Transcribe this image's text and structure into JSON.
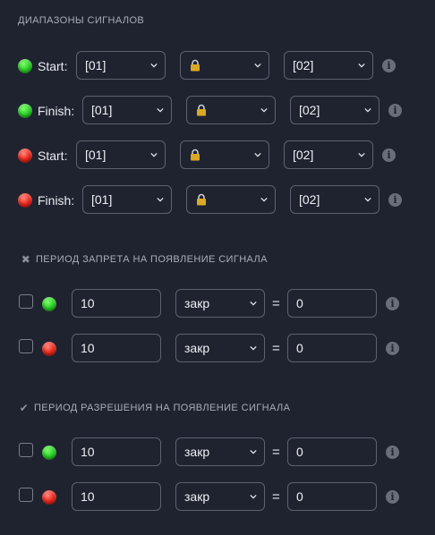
{
  "signal_ranges": {
    "title": "ДИАПАЗОНЫ СИГНАЛОВ",
    "rows": [
      {
        "color": "green",
        "label": "Start:",
        "from": "[01]",
        "to": "[02]"
      },
      {
        "color": "green",
        "label": "Finish:",
        "from": "[01]",
        "to": "[02]"
      },
      {
        "color": "red",
        "label": "Start:",
        "from": "[01]",
        "to": "[02]"
      },
      {
        "color": "red",
        "label": "Finish:",
        "from": "[01]",
        "to": "[02]"
      }
    ]
  },
  "ban_period": {
    "title": "ПЕРИОД ЗАПРЕТА НА ПОЯВЛЕНИЕ СИГНАЛА",
    "mark": "✖",
    "rows": [
      {
        "color": "green",
        "value": "10",
        "unit": "закр",
        "equals": "=",
        "result": "0",
        "checked": false
      },
      {
        "color": "red",
        "value": "10",
        "unit": "закр",
        "equals": "=",
        "result": "0",
        "checked": false
      }
    ]
  },
  "allow_period": {
    "title": "ПЕРИОД РАЗРЕШЕНИЯ НА ПОЯВЛЕНИЕ СИГНАЛА",
    "mark": "✔",
    "rows": [
      {
        "color": "green",
        "value": "10",
        "unit": "закр",
        "equals": "=",
        "result": "0",
        "checked": false
      },
      {
        "color": "red",
        "value": "10",
        "unit": "закр",
        "equals": "=",
        "result": "0",
        "checked": false
      }
    ]
  },
  "icons": {
    "chevron": "chevron-down-icon",
    "lock": "lock-icon",
    "info": "info-icon",
    "info_glyph": "i"
  },
  "colors": {
    "background": "#1f2330",
    "border": "#5e6270",
    "green": "#2fd12a",
    "red": "#ee2a1e"
  }
}
